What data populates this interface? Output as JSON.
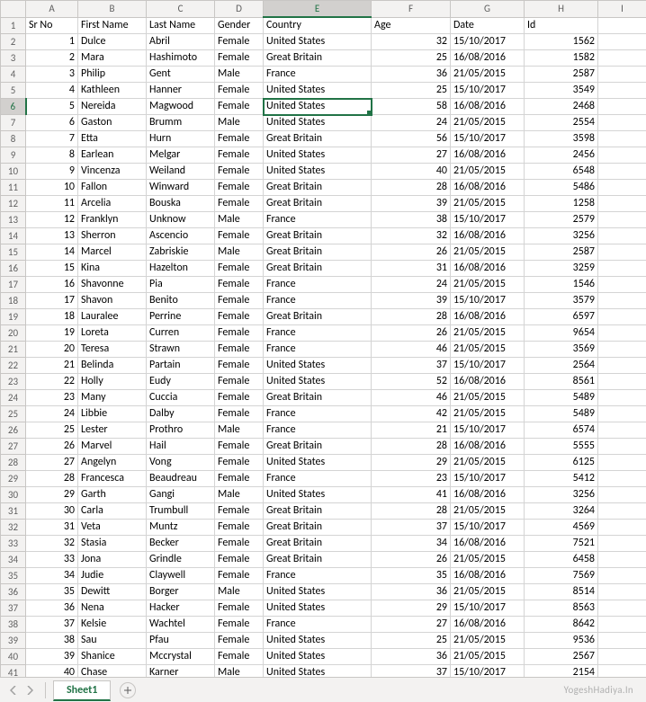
{
  "col_letters": [
    "A",
    "B",
    "C",
    "D",
    "E",
    "F",
    "G",
    "H",
    "I"
  ],
  "selected_col_index": 4,
  "selected_row_index": 5,
  "selected_cell": {
    "row": 6,
    "col": "E"
  },
  "headers": [
    "Sr No",
    "First Name",
    "Last Name",
    "Gender",
    "Country",
    "Age",
    "Date",
    "Id"
  ],
  "rows": [
    {
      "n": 1,
      "sr": 1,
      "fn": "Dulce",
      "ln": "Abril",
      "g": "Female",
      "c": "United States",
      "age": 32,
      "d": "15/10/2017",
      "id": 1562
    },
    {
      "n": 2,
      "sr": 2,
      "fn": "Mara",
      "ln": "Hashimoto",
      "g": "Female",
      "c": "Great Britain",
      "age": 25,
      "d": "16/08/2016",
      "id": 1582
    },
    {
      "n": 3,
      "sr": 3,
      "fn": "Philip",
      "ln": "Gent",
      "g": "Male",
      "c": "France",
      "age": 36,
      "d": "21/05/2015",
      "id": 2587
    },
    {
      "n": 4,
      "sr": 4,
      "fn": "Kathleen",
      "ln": "Hanner",
      "g": "Female",
      "c": "United States",
      "age": 25,
      "d": "15/10/2017",
      "id": 3549
    },
    {
      "n": 5,
      "sr": 5,
      "fn": "Nereida",
      "ln": "Magwood",
      "g": "Female",
      "c": "United States",
      "age": 58,
      "d": "16/08/2016",
      "id": 2468
    },
    {
      "n": 6,
      "sr": 6,
      "fn": "Gaston",
      "ln": "Brumm",
      "g": "Male",
      "c": "United States",
      "age": 24,
      "d": "21/05/2015",
      "id": 2554
    },
    {
      "n": 7,
      "sr": 7,
      "fn": "Etta",
      "ln": "Hurn",
      "g": "Female",
      "c": "Great Britain",
      "age": 56,
      "d": "15/10/2017",
      "id": 3598
    },
    {
      "n": 8,
      "sr": 8,
      "fn": "Earlean",
      "ln": "Melgar",
      "g": "Female",
      "c": "United States",
      "age": 27,
      "d": "16/08/2016",
      "id": 2456
    },
    {
      "n": 9,
      "sr": 9,
      "fn": "Vincenza",
      "ln": "Weiland",
      "g": "Female",
      "c": "United States",
      "age": 40,
      "d": "21/05/2015",
      "id": 6548
    },
    {
      "n": 10,
      "sr": 10,
      "fn": "Fallon",
      "ln": "Winward",
      "g": "Female",
      "c": "Great Britain",
      "age": 28,
      "d": "16/08/2016",
      "id": 5486
    },
    {
      "n": 11,
      "sr": 11,
      "fn": "Arcelia",
      "ln": "Bouska",
      "g": "Female",
      "c": "Great Britain",
      "age": 39,
      "d": "21/05/2015",
      "id": 1258
    },
    {
      "n": 12,
      "sr": 12,
      "fn": "Franklyn",
      "ln": "Unknow",
      "g": "Male",
      "c": "France",
      "age": 38,
      "d": "15/10/2017",
      "id": 2579
    },
    {
      "n": 13,
      "sr": 13,
      "fn": "Sherron",
      "ln": "Ascencio",
      "g": "Female",
      "c": "Great Britain",
      "age": 32,
      "d": "16/08/2016",
      "id": 3256
    },
    {
      "n": 14,
      "sr": 14,
      "fn": "Marcel",
      "ln": "Zabriskie",
      "g": "Male",
      "c": "Great Britain",
      "age": 26,
      "d": "21/05/2015",
      "id": 2587
    },
    {
      "n": 15,
      "sr": 15,
      "fn": "Kina",
      "ln": "Hazelton",
      "g": "Female",
      "c": "Great Britain",
      "age": 31,
      "d": "16/08/2016",
      "id": 3259
    },
    {
      "n": 16,
      "sr": 16,
      "fn": "Shavonne",
      "ln": "Pia",
      "g": "Female",
      "c": "France",
      "age": 24,
      "d": "21/05/2015",
      "id": 1546
    },
    {
      "n": 17,
      "sr": 17,
      "fn": "Shavon",
      "ln": "Benito",
      "g": "Female",
      "c": "France",
      "age": 39,
      "d": "15/10/2017",
      "id": 3579
    },
    {
      "n": 18,
      "sr": 18,
      "fn": "Lauralee",
      "ln": "Perrine",
      "g": "Female",
      "c": "Great Britain",
      "age": 28,
      "d": "16/08/2016",
      "id": 6597
    },
    {
      "n": 19,
      "sr": 19,
      "fn": "Loreta",
      "ln": "Curren",
      "g": "Female",
      "c": "France",
      "age": 26,
      "d": "21/05/2015",
      "id": 9654
    },
    {
      "n": 20,
      "sr": 20,
      "fn": "Teresa",
      "ln": "Strawn",
      "g": "Female",
      "c": "France",
      "age": 46,
      "d": "21/05/2015",
      "id": 3569
    },
    {
      "n": 21,
      "sr": 21,
      "fn": "Belinda",
      "ln": "Partain",
      "g": "Female",
      "c": "United States",
      "age": 37,
      "d": "15/10/2017",
      "id": 2564
    },
    {
      "n": 22,
      "sr": 22,
      "fn": "Holly",
      "ln": "Eudy",
      "g": "Female",
      "c": "United States",
      "age": 52,
      "d": "16/08/2016",
      "id": 8561
    },
    {
      "n": 23,
      "sr": 23,
      "fn": "Many",
      "ln": "Cuccia",
      "g": "Female",
      "c": "Great Britain",
      "age": 46,
      "d": "21/05/2015",
      "id": 5489
    },
    {
      "n": 24,
      "sr": 24,
      "fn": "Libbie",
      "ln": "Dalby",
      "g": "Female",
      "c": "France",
      "age": 42,
      "d": "21/05/2015",
      "id": 5489
    },
    {
      "n": 25,
      "sr": 25,
      "fn": "Lester",
      "ln": "Prothro",
      "g": "Male",
      "c": "France",
      "age": 21,
      "d": "15/10/2017",
      "id": 6574
    },
    {
      "n": 26,
      "sr": 26,
      "fn": "Marvel",
      "ln": "Hail",
      "g": "Female",
      "c": "Great Britain",
      "age": 28,
      "d": "16/08/2016",
      "id": 5555
    },
    {
      "n": 27,
      "sr": 27,
      "fn": "Angelyn",
      "ln": "Vong",
      "g": "Female",
      "c": "United States",
      "age": 29,
      "d": "21/05/2015",
      "id": 6125
    },
    {
      "n": 28,
      "sr": 28,
      "fn": "Francesca",
      "ln": "Beaudreau",
      "g": "Female",
      "c": "France",
      "age": 23,
      "d": "15/10/2017",
      "id": 5412
    },
    {
      "n": 29,
      "sr": 29,
      "fn": "Garth",
      "ln": "Gangi",
      "g": "Male",
      "c": "United States",
      "age": 41,
      "d": "16/08/2016",
      "id": 3256
    },
    {
      "n": 30,
      "sr": 30,
      "fn": "Carla",
      "ln": "Trumbull",
      "g": "Female",
      "c": "Great Britain",
      "age": 28,
      "d": "21/05/2015",
      "id": 3264
    },
    {
      "n": 31,
      "sr": 31,
      "fn": "Veta",
      "ln": "Muntz",
      "g": "Female",
      "c": "Great Britain",
      "age": 37,
      "d": "15/10/2017",
      "id": 4569
    },
    {
      "n": 32,
      "sr": 32,
      "fn": "Stasia",
      "ln": "Becker",
      "g": "Female",
      "c": "Great Britain",
      "age": 34,
      "d": "16/08/2016",
      "id": 7521
    },
    {
      "n": 33,
      "sr": 33,
      "fn": "Jona",
      "ln": "Grindle",
      "g": "Female",
      "c": "Great Britain",
      "age": 26,
      "d": "21/05/2015",
      "id": 6458
    },
    {
      "n": 34,
      "sr": 34,
      "fn": "Judie",
      "ln": "Claywell",
      "g": "Female",
      "c": "France",
      "age": 35,
      "d": "16/08/2016",
      "id": 7569
    },
    {
      "n": 35,
      "sr": 35,
      "fn": "Dewitt",
      "ln": "Borger",
      "g": "Male",
      "c": "United States",
      "age": 36,
      "d": "21/05/2015",
      "id": 8514
    },
    {
      "n": 36,
      "sr": 36,
      "fn": "Nena",
      "ln": "Hacker",
      "g": "Female",
      "c": "United States",
      "age": 29,
      "d": "15/10/2017",
      "id": 8563
    },
    {
      "n": 37,
      "sr": 37,
      "fn": "Kelsie",
      "ln": "Wachtel",
      "g": "Female",
      "c": "France",
      "age": 27,
      "d": "16/08/2016",
      "id": 8642
    },
    {
      "n": 38,
      "sr": 38,
      "fn": "Sau",
      "ln": "Pfau",
      "g": "Female",
      "c": "United States",
      "age": 25,
      "d": "21/05/2015",
      "id": 9536
    },
    {
      "n": 39,
      "sr": 39,
      "fn": "Shanice",
      "ln": "Mccrystal",
      "g": "Female",
      "c": "United States",
      "age": 36,
      "d": "21/05/2015",
      "id": 2567
    },
    {
      "n": 40,
      "sr": 40,
      "fn": "Chase",
      "ln": "Karner",
      "g": "Male",
      "c": "United States",
      "age": 37,
      "d": "15/10/2017",
      "id": 2154
    }
  ],
  "tabstrip": {
    "sheet_name": "Sheet1",
    "watermark": "YogeshHadiya.In",
    "add_tooltip": "New sheet"
  }
}
